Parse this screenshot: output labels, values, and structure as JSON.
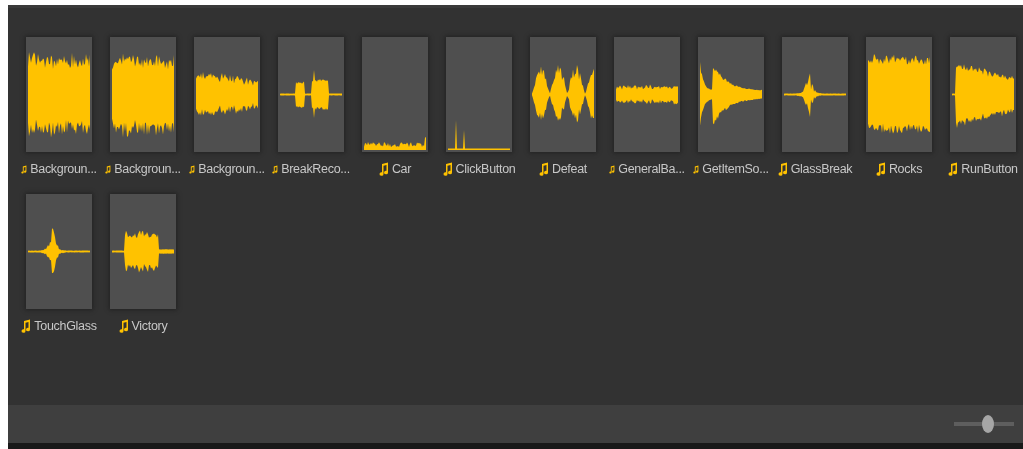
{
  "assets": [
    {
      "label": "Backgroun...",
      "kind": "dense",
      "small_icon": true
    },
    {
      "label": "Backgroun...",
      "kind": "dense",
      "small_icon": true
    },
    {
      "label": "Backgroun...",
      "kind": "fading",
      "small_icon": true
    },
    {
      "label": "BreakReco...",
      "kind": "blocks",
      "small_icon": true
    },
    {
      "label": "Car",
      "kind": "floor",
      "small_icon": false
    },
    {
      "label": "ClickButton",
      "kind": "clicks",
      "small_icon": false
    },
    {
      "label": "Defeat",
      "kind": "pulses",
      "small_icon": false
    },
    {
      "label": "GeneralBa...",
      "kind": "band",
      "small_icon": true
    },
    {
      "label": "GetItemSo...",
      "kind": "decay",
      "small_icon": true
    },
    {
      "label": "GlassBreak",
      "kind": "crack",
      "small_icon": false
    },
    {
      "label": "Rocks",
      "kind": "loud",
      "small_icon": false
    },
    {
      "label": "RunButton",
      "kind": "ramp",
      "small_icon": false
    },
    {
      "label": "TouchGlass",
      "kind": "crack",
      "small_icon": false
    },
    {
      "label": "Victory",
      "kind": "block",
      "small_icon": false
    }
  ],
  "zoom_slider": {
    "level": 0.58
  }
}
